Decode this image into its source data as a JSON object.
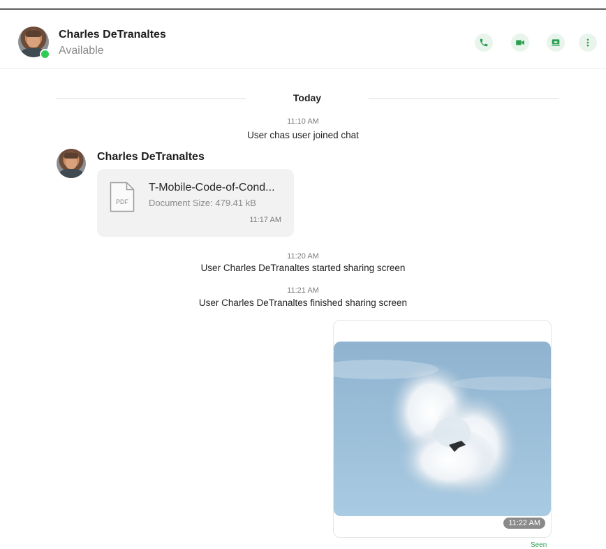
{
  "header": {
    "contact_name": "Charles DeTranaltes",
    "status": "Available",
    "actions": [
      {
        "name": "call-button",
        "icon": "phone-icon"
      },
      {
        "name": "video-call-button",
        "icon": "video-icon"
      },
      {
        "name": "share-screen-button",
        "icon": "screen-share-icon"
      },
      {
        "name": "more-options-button",
        "icon": "vertical-dots-icon"
      }
    ],
    "accent_color": "#2a9d4f",
    "presence_color": "#2ecc55"
  },
  "chat": {
    "day_divider": "Today",
    "events": [
      {
        "time": "11:10 AM",
        "text": "User chas user joined chat"
      },
      {
        "time": "11:20 AM",
        "text": "User Charles DeTranaltes started sharing screen"
      },
      {
        "time": "11:21 AM",
        "text": "User Charles DeTranaltes finished sharing screen"
      }
    ],
    "incoming_message": {
      "sender": "Charles DeTranaltes",
      "file": {
        "type_label": "PDF",
        "name": "T-Mobile-Code-of-Cond...",
        "size": "Document Size: 479.41 kB",
        "time": "11:17 AM"
      }
    },
    "outgoing_image": {
      "time": "11:22 AM",
      "status": "Seen"
    }
  }
}
